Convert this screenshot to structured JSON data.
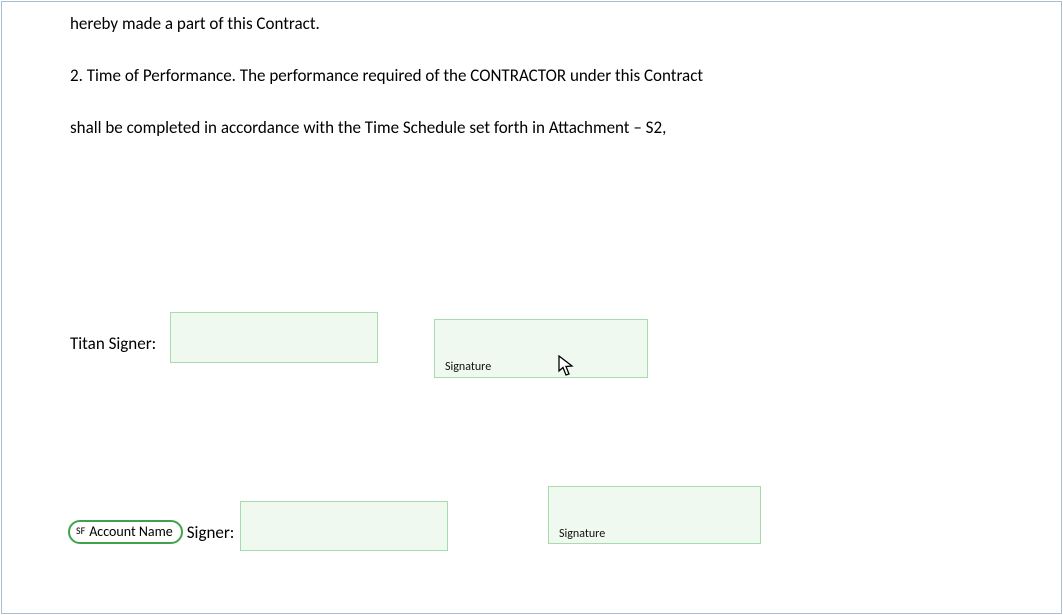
{
  "paragraphs": {
    "p1": "hereby made a part of this Contract.",
    "p2": "2. Time of Performance. The performance required of the CONTRACTOR under this Contract",
    "p3": "shall be completed in accordance with the Time Schedule set forth in Attachment – S2,"
  },
  "signer1": {
    "label": "Titan Signer:",
    "signature_label": "Signature"
  },
  "signer2": {
    "sf_badge": "SF",
    "sf_field_name": "Account Name",
    "suffix": "Signer:",
    "signature_label": "Signature"
  }
}
